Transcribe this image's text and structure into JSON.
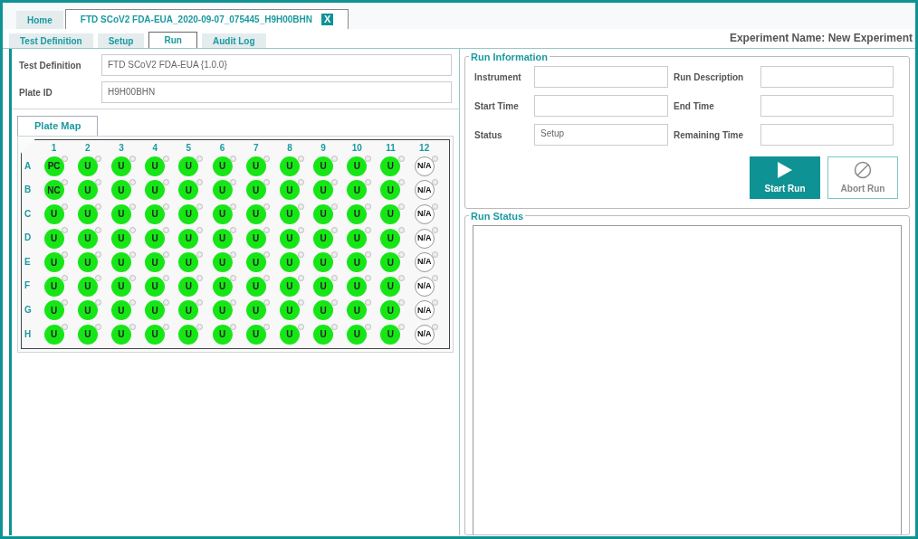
{
  "document_tabs": [
    {
      "label": "Home",
      "selected": false
    },
    {
      "label": "FTD SCoV2 FDA-EUA_2020-09-07_075445_H9H00BHN",
      "selected": true,
      "close_button": "X"
    }
  ],
  "section_tabs": [
    {
      "label": "Test Definition",
      "selected": false
    },
    {
      "label": "Setup",
      "selected": false
    },
    {
      "label": "Run",
      "selected": true
    },
    {
      "label": "Audit Log",
      "selected": false
    }
  ],
  "experiment_name": "Experiment Name: New Experiment",
  "test_info": [
    {
      "label": "Test Definition",
      "value": "FTD SCoV2 FDA-EUA {1.0.0}"
    },
    {
      "label": "Plate ID",
      "value": "H9H00BHN"
    }
  ],
  "plate_map": {
    "tab": "Plate Map",
    "columns": [
      "1",
      "2",
      "3",
      "4",
      "5",
      "6",
      "7",
      "8",
      "9",
      "10",
      "11",
      "12"
    ],
    "rows": [
      {
        "label": "A",
        "wells": [
          {
            "label": "PC",
            "kind": "filled"
          },
          {
            "label": "U",
            "kind": "filled"
          },
          {
            "label": "U",
            "kind": "filled"
          },
          {
            "label": "U",
            "kind": "filled"
          },
          {
            "label": "U",
            "kind": "filled"
          },
          {
            "label": "U",
            "kind": "filled"
          },
          {
            "label": "U",
            "kind": "filled"
          },
          {
            "label": "U",
            "kind": "filled"
          },
          {
            "label": "U",
            "kind": "filled"
          },
          {
            "label": "U",
            "kind": "filled"
          },
          {
            "label": "U",
            "kind": "filled"
          },
          {
            "label": "N/A",
            "kind": "empty"
          }
        ]
      },
      {
        "label": "B",
        "wells": [
          {
            "label": "NC",
            "kind": "filled"
          },
          {
            "label": "U",
            "kind": "filled"
          },
          {
            "label": "U",
            "kind": "filled"
          },
          {
            "label": "U",
            "kind": "filled"
          },
          {
            "label": "U",
            "kind": "filled"
          },
          {
            "label": "U",
            "kind": "filled"
          },
          {
            "label": "U",
            "kind": "filled"
          },
          {
            "label": "U",
            "kind": "filled"
          },
          {
            "label": "U",
            "kind": "filled"
          },
          {
            "label": "U",
            "kind": "filled"
          },
          {
            "label": "U",
            "kind": "filled"
          },
          {
            "label": "N/A",
            "kind": "empty"
          }
        ]
      },
      {
        "label": "C",
        "wells": [
          {
            "label": "U",
            "kind": "filled"
          },
          {
            "label": "U",
            "kind": "filled"
          },
          {
            "label": "U",
            "kind": "filled"
          },
          {
            "label": "U",
            "kind": "filled"
          },
          {
            "label": "U",
            "kind": "filled"
          },
          {
            "label": "U",
            "kind": "filled"
          },
          {
            "label": "U",
            "kind": "filled"
          },
          {
            "label": "U",
            "kind": "filled"
          },
          {
            "label": "U",
            "kind": "filled"
          },
          {
            "label": "U",
            "kind": "filled"
          },
          {
            "label": "U",
            "kind": "filled"
          },
          {
            "label": "N/A",
            "kind": "empty"
          }
        ]
      },
      {
        "label": "D",
        "wells": [
          {
            "label": "U",
            "kind": "filled"
          },
          {
            "label": "U",
            "kind": "filled"
          },
          {
            "label": "U",
            "kind": "filled"
          },
          {
            "label": "U",
            "kind": "filled"
          },
          {
            "label": "U",
            "kind": "filled"
          },
          {
            "label": "U",
            "kind": "filled"
          },
          {
            "label": "U",
            "kind": "filled"
          },
          {
            "label": "U",
            "kind": "filled"
          },
          {
            "label": "U",
            "kind": "filled"
          },
          {
            "label": "U",
            "kind": "filled"
          },
          {
            "label": "U",
            "kind": "filled"
          },
          {
            "label": "N/A",
            "kind": "empty"
          }
        ]
      },
      {
        "label": "E",
        "wells": [
          {
            "label": "U",
            "kind": "filled"
          },
          {
            "label": "U",
            "kind": "filled"
          },
          {
            "label": "U",
            "kind": "filled"
          },
          {
            "label": "U",
            "kind": "filled"
          },
          {
            "label": "U",
            "kind": "filled"
          },
          {
            "label": "U",
            "kind": "filled"
          },
          {
            "label": "U",
            "kind": "filled"
          },
          {
            "label": "U",
            "kind": "filled"
          },
          {
            "label": "U",
            "kind": "filled"
          },
          {
            "label": "U",
            "kind": "filled"
          },
          {
            "label": "U",
            "kind": "filled"
          },
          {
            "label": "N/A",
            "kind": "empty"
          }
        ]
      },
      {
        "label": "F",
        "wells": [
          {
            "label": "U",
            "kind": "filled"
          },
          {
            "label": "U",
            "kind": "filled"
          },
          {
            "label": "U",
            "kind": "filled"
          },
          {
            "label": "U",
            "kind": "filled"
          },
          {
            "label": "U",
            "kind": "filled"
          },
          {
            "label": "U",
            "kind": "filled"
          },
          {
            "label": "U",
            "kind": "filled"
          },
          {
            "label": "U",
            "kind": "filled"
          },
          {
            "label": "U",
            "kind": "filled"
          },
          {
            "label": "U",
            "kind": "filled"
          },
          {
            "label": "U",
            "kind": "filled"
          },
          {
            "label": "N/A",
            "kind": "empty"
          }
        ]
      },
      {
        "label": "G",
        "wells": [
          {
            "label": "U",
            "kind": "filled"
          },
          {
            "label": "U",
            "kind": "filled"
          },
          {
            "label": "U",
            "kind": "filled"
          },
          {
            "label": "U",
            "kind": "filled"
          },
          {
            "label": "U",
            "kind": "filled"
          },
          {
            "label": "U",
            "kind": "filled"
          },
          {
            "label": "U",
            "kind": "filled"
          },
          {
            "label": "U",
            "kind": "filled"
          },
          {
            "label": "U",
            "kind": "filled"
          },
          {
            "label": "U",
            "kind": "filled"
          },
          {
            "label": "U",
            "kind": "filled"
          },
          {
            "label": "N/A",
            "kind": "empty"
          }
        ]
      },
      {
        "label": "H",
        "wells": [
          {
            "label": "U",
            "kind": "filled"
          },
          {
            "label": "U",
            "kind": "filled"
          },
          {
            "label": "U",
            "kind": "filled"
          },
          {
            "label": "U",
            "kind": "filled"
          },
          {
            "label": "U",
            "kind": "filled"
          },
          {
            "label": "U",
            "kind": "filled"
          },
          {
            "label": "U",
            "kind": "filled"
          },
          {
            "label": "U",
            "kind": "filled"
          },
          {
            "label": "U",
            "kind": "filled"
          },
          {
            "label": "U",
            "kind": "filled"
          },
          {
            "label": "U",
            "kind": "filled"
          },
          {
            "label": "N/A",
            "kind": "empty"
          }
        ]
      }
    ]
  },
  "run_information": {
    "title": "Run Information",
    "fields": [
      {
        "label": "Instrument"
      },
      {
        "label": "Run Description"
      },
      {
        "label": "Start Time"
      },
      {
        "label": "End Time"
      },
      {
        "label": "Status",
        "value": "Setup"
      },
      {
        "label": "Remaining Time"
      }
    ],
    "buttons": [
      {
        "label": "Start Run",
        "kind": "start",
        "disabled": false
      },
      {
        "label": "Abort Run",
        "kind": "abort",
        "disabled": true
      }
    ]
  },
  "run_status": {
    "title": "Run Status"
  }
}
